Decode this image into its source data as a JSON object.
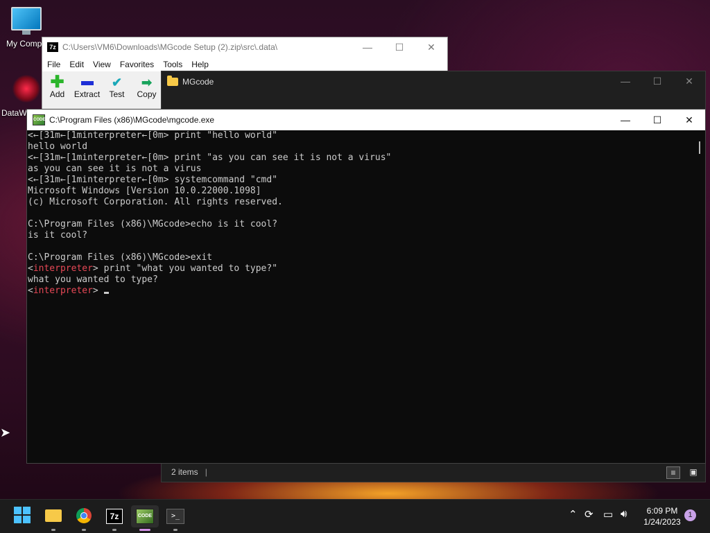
{
  "desktop": {
    "icons": [
      {
        "label": "My Compu",
        "icon": "monitor-icon"
      },
      {
        "label": "DataW",
        "icon": "datawave-icon"
      }
    ]
  },
  "window_7zip": {
    "title": "C:\\Users\\VM6\\Downloads\\MGcode Setup (2).zip\\src\\.data\\",
    "badge": "7z",
    "menu": [
      "File",
      "Edit",
      "View",
      "Favorites",
      "Tools",
      "Help"
    ],
    "toolbar": [
      {
        "label": "Add",
        "icon": "plus-icon"
      },
      {
        "label": "Extract",
        "icon": "minus-icon"
      },
      {
        "label": "Test",
        "icon": "checkmark-icon"
      },
      {
        "label": "Copy",
        "icon": "arrow-right-icon"
      }
    ]
  },
  "explorer": {
    "title": "MGcode",
    "status": "2 items",
    "divider": "|"
  },
  "console": {
    "title": "C:\\Program Files (x86)\\MGcode\\mgcode.exe",
    "lines": [
      "<←[31m←[1minterpreter←[0m> print \"hello world\"",
      "hello world",
      "<←[31m←[1minterpreter←[0m> print \"as you can see it is not a virus\"",
      "as you can see it is not a virus",
      "<←[31m←[1minterpreter←[0m> systemcommand \"cmd\"",
      "Microsoft Windows [Version 10.0.22000.1098]",
      "(c) Microsoft Corporation. All rights reserved.",
      "",
      "C:\\Program Files (x86)\\MGcode>echo is it cool?",
      "is it cool?",
      "",
      "C:\\Program Files (x86)\\MGcode>exit"
    ],
    "prompt_open": "<",
    "prompt_word": "interpreter",
    "prompt_close": ">",
    "last_command": " print \"what you wanted to type?\"",
    "last_output": "what you wanted to type?"
  },
  "window_controls": {
    "minimize": "—",
    "maximize": "☐",
    "close": "✕"
  },
  "taskbar": {
    "apps": [
      "start-button",
      "file-explorer-icon",
      "chrome-icon",
      "7zip-icon",
      "mgcode-icon",
      "terminal-icon"
    ],
    "badge_7z": "7z",
    "badge_code": "CODE",
    "clock_time": "6:09 PM",
    "clock_date": "1/24/2023",
    "notifications": "1"
  }
}
